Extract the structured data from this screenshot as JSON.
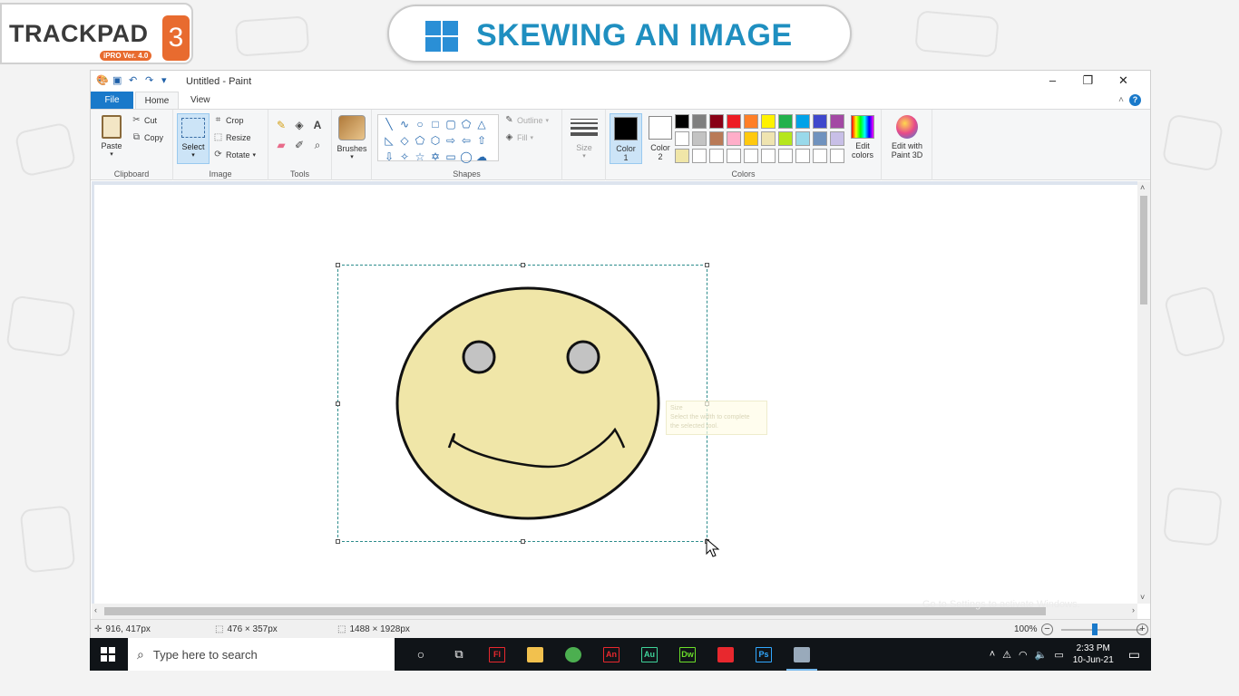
{
  "banner": {
    "brand_text": "TRACKPAD",
    "brand_version": "iPRO Ver. 4.0",
    "brand_number": "3",
    "title": "SKEWING AN IMAGE",
    "title_color": "#1f8fc0",
    "accent_color": "#e86b2f"
  },
  "window": {
    "title": "Untitled - Paint",
    "controls": [
      "–",
      "❐",
      "✕"
    ]
  },
  "menu": {
    "file": "File",
    "tabs": [
      "Home",
      "View"
    ]
  },
  "ribbon": {
    "clipboard": {
      "label": "Clipboard",
      "paste": "Paste",
      "cut": "Cut",
      "copy": "Copy"
    },
    "image": {
      "label": "Image",
      "select": "Select",
      "crop": "Crop",
      "resize": "Resize",
      "rotate": "Rotate"
    },
    "tools": {
      "label": "Tools"
    },
    "brushes": {
      "label": "Brushes"
    },
    "shapes": {
      "label": "Shapes",
      "outline": "Outline",
      "fill": "Fill"
    },
    "size": {
      "label": "Size"
    },
    "colors": {
      "label": "Colors",
      "color1": "Color",
      "color1_num": "1",
      "color2": "Color",
      "color2_num": "2",
      "color1_value": "#000000",
      "color2_value": "#ffffff",
      "edit_colors_line1": "Edit",
      "edit_colors_line2": "colors",
      "palette": [
        "#000000",
        "#7f7f7f",
        "#880015",
        "#ed1c24",
        "#ff7f27",
        "#fff200",
        "#22b14c",
        "#00a2e8",
        "#3f48cc",
        "#a349a4",
        "#ffffff",
        "#c3c3c3",
        "#b97a57",
        "#ffaec9",
        "#ffc90e",
        "#efe4b0",
        "#b5e61d",
        "#99d9ea",
        "#7092be",
        "#c8bfe7",
        "#f0e6a8",
        "#ffffff",
        "#ffffff",
        "#ffffff",
        "#ffffff",
        "#ffffff",
        "#ffffff",
        "#ffffff",
        "#ffffff",
        "#ffffff"
      ]
    },
    "paint3d": {
      "line1": "Edit with",
      "line2": "Paint 3D"
    }
  },
  "canvas": {
    "tooltip_line1": "Size",
    "tooltip_line2": "Select the width to complete",
    "tooltip_line3": "the selected tool."
  },
  "status": {
    "cursor": "916, 417px",
    "selection": "476 × 357px",
    "image_size": "1488 × 1928px",
    "zoom": "100%",
    "watermark": "Go to Settings to activate Windows."
  },
  "taskbar": {
    "search_placeholder": "Type here to search",
    "apps": [
      {
        "name": "flash",
        "label": "Fl",
        "color": "#e8282e"
      },
      {
        "name": "file-explorer",
        "label": "",
        "color": "#f2c14e"
      },
      {
        "name": "chrome",
        "label": "",
        "color": "#4caf50"
      },
      {
        "name": "animate",
        "label": "An",
        "color": "#e8282e"
      },
      {
        "name": "audition",
        "label": "Au",
        "color": "#3fd49a"
      },
      {
        "name": "dreamweaver",
        "label": "Dw",
        "color": "#6cdf2a"
      },
      {
        "name": "acrobat",
        "label": "",
        "color": "#e8282e"
      },
      {
        "name": "photoshop",
        "label": "Ps",
        "color": "#31a8ff"
      },
      {
        "name": "paint",
        "label": "",
        "color": "#9ab"
      }
    ],
    "time": "2:33 PM",
    "date": "10-Jun-21"
  }
}
